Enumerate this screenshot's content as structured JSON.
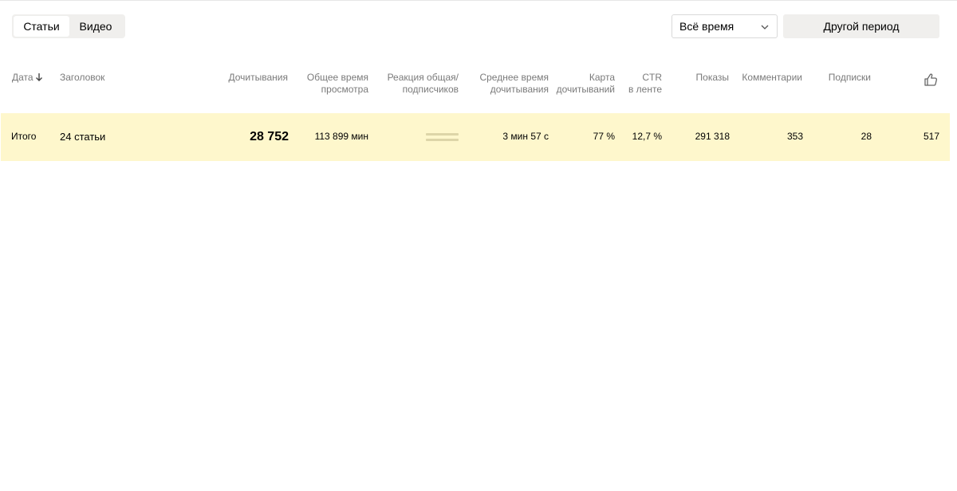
{
  "tabs": [
    {
      "label": "Статьи",
      "active": true
    },
    {
      "label": "Видео",
      "active": false
    }
  ],
  "period": {
    "selected": "Всё время",
    "other_period_label": "Другой период"
  },
  "table": {
    "headers": {
      "date": "Дата",
      "title": "Заголовок",
      "reads": "Дочитывания",
      "total_time_1": "Общее время",
      "total_time_2": "просмотра",
      "reaction_1": "Реакция общая/",
      "reaction_2": "подписчиков",
      "avg_time_1": "Среднее время",
      "avg_time_2": "дочитывания",
      "map_1": "Карта",
      "map_2": "дочитываний",
      "ctr_1": "CTR",
      "ctr_2": "в ленте",
      "impressions": "Показы",
      "comments": "Комментарии",
      "subscriptions": "Подписки"
    },
    "total": {
      "label": "Итого",
      "articles": "24 статьи",
      "reads": "28 752",
      "total_time": "113 899 мин",
      "avg_time": "3 мин 57 с",
      "read_map": "77 %",
      "ctr": "12,7 %",
      "impressions": "291 318",
      "comments": "353",
      "subscriptions": "28",
      "likes": "517"
    }
  },
  "colors": {
    "total_row_bg": "#fef7cc",
    "tabs_bg": "#f0efed",
    "header_text": "#7a7a7a"
  }
}
